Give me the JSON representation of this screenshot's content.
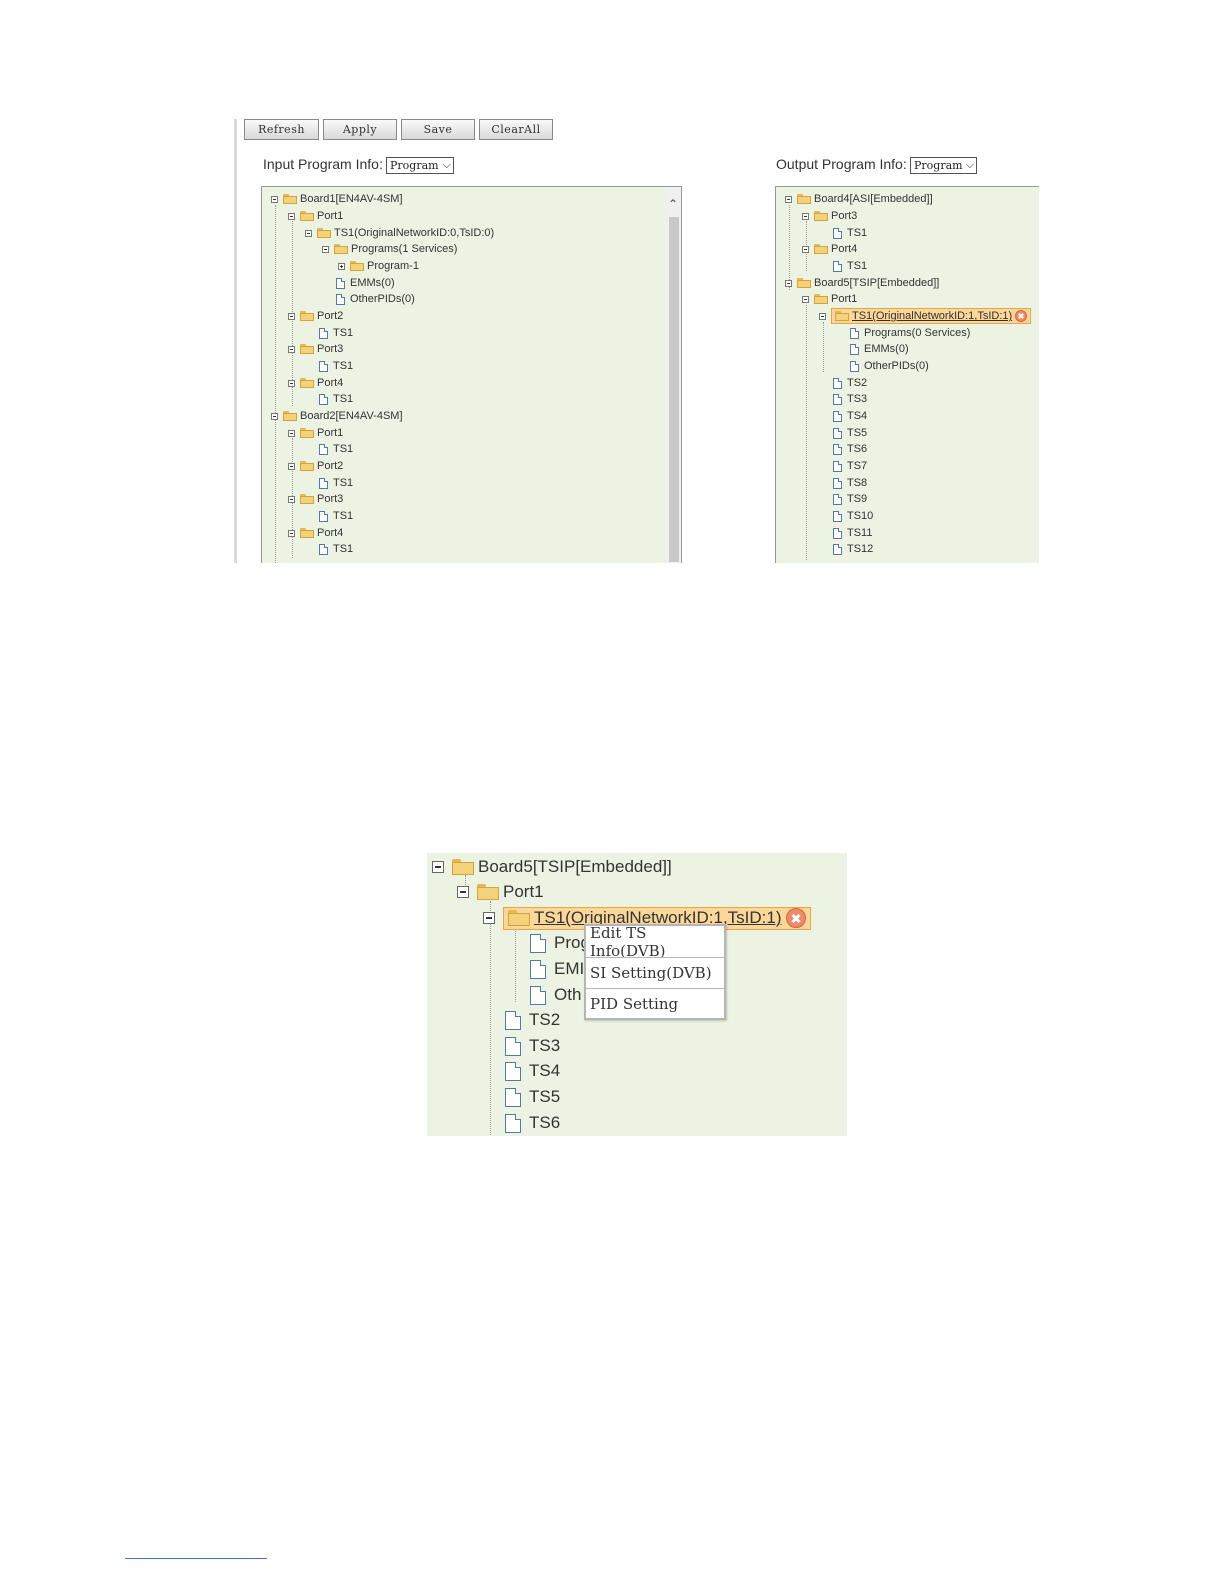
{
  "toolbar": {
    "buttons": [
      "Refresh",
      "Apply",
      "Save",
      "ClearAll"
    ]
  },
  "input_panel": {
    "label": "Input Program Info:",
    "select_value": "Program",
    "tree": [
      "Board1[EN4AV-4SM]",
      "Port1",
      "TS1(OriginalNetworkID:0,TsID:0)",
      "Programs(1 Services)",
      "Program-1",
      "EMMs(0)",
      "OtherPIDs(0)",
      "Port2",
      "TS1",
      "Port3",
      "TS1",
      "Port4",
      "TS1",
      "Board2[EN4AV-4SM]",
      "Port1",
      "TS1",
      "Port2",
      "TS1",
      "Port3",
      "TS1",
      "Port4",
      "TS1"
    ]
  },
  "output_panel": {
    "label": "Output Program Info:",
    "select_value": "Program",
    "tree": [
      "Board4[ASI[Embedded]]",
      "Port3",
      "TS1",
      "Port4",
      "TS1",
      "Board5[TSIP[Embedded]]",
      "Port1",
      "TS1(OriginalNetworkID:1,TsID:1)",
      "Programs(0 Services)",
      "EMMs(0)",
      "OtherPIDs(0)",
      "TS2",
      "TS3",
      "TS4",
      "TS5",
      "TS6",
      "TS7",
      "TS8",
      "TS9",
      "TS10",
      "TS11",
      "TS12"
    ]
  },
  "zoom": {
    "tree": [
      "Board5[TSIP[Embedded]]",
      "Port1",
      "TS1(OriginalNetworkID:1,TsID:1)",
      "Prog",
      "EMI",
      "Oth",
      "TS2",
      "TS3",
      "TS4",
      "TS5",
      "TS6"
    ],
    "context_menu": [
      "Edit TS Info(DVB)",
      "SI Setting(DVB)",
      "PID Setting"
    ]
  }
}
